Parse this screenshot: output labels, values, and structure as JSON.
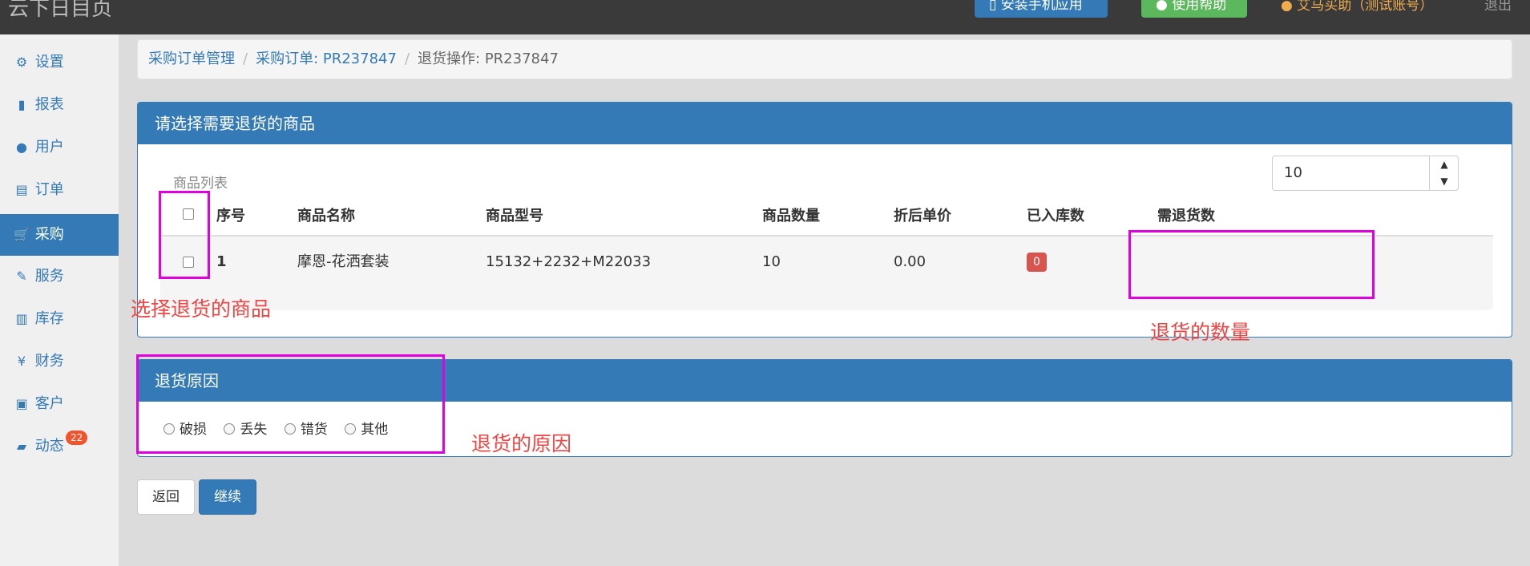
{
  "topbar": {
    "brand": "云下日目页",
    "install_label": "安装手机应用",
    "help_label": "使用帮助",
    "user_label": "艾马买助（测试账号）",
    "exit_label": "退出"
  },
  "sidebar": {
    "items": [
      {
        "label": "设置",
        "icon": "gear-icon",
        "glyph": "⚙"
      },
      {
        "label": "报表",
        "icon": "bar-chart-icon",
        "glyph": "▮"
      },
      {
        "label": "用户",
        "icon": "user-icon",
        "glyph": "●"
      },
      {
        "label": "订单",
        "icon": "list-icon",
        "glyph": "▤"
      },
      {
        "label": "采购",
        "icon": "cart-icon",
        "glyph": "🛒"
      },
      {
        "label": "服务",
        "icon": "wrench-icon",
        "glyph": "✎"
      },
      {
        "label": "库存",
        "icon": "barcode-icon",
        "glyph": "▥"
      },
      {
        "label": "财务",
        "icon": "yen-icon",
        "glyph": "¥"
      },
      {
        "label": "客户",
        "icon": "briefcase-icon",
        "glyph": "▣"
      },
      {
        "label": "动态",
        "icon": "comment-icon",
        "glyph": "▰",
        "badge": "22"
      }
    ],
    "active": "采购"
  },
  "breadcrumb": {
    "items": [
      "采购订单管理",
      "采购订单: PR237847"
    ],
    "current": "退货操作: PR237847",
    "sep": "/"
  },
  "panel_items": {
    "title": "请选择需要退货的商品",
    "list_title": "商品列表",
    "columns": [
      "序号",
      "商品名称",
      "商品型号",
      "商品数量",
      "折后单价",
      "已入库数",
      "需退货数"
    ],
    "rows": [
      {
        "index": "1",
        "name": "摩恩-花洒套装",
        "model": "15132+2232+M22033",
        "qty": "10",
        "price": "0.00",
        "received": "0",
        "return_qty": "10"
      }
    ]
  },
  "panel_reason": {
    "title": "退货原因",
    "options": [
      "破损",
      "丢失",
      "错货",
      "其他"
    ]
  },
  "actions": {
    "back_label": "返回",
    "next_label": "继续"
  },
  "annotations": {
    "select_items": "选择退货的商品",
    "return_qty": "退货的数量",
    "return_reason": "退货的原因",
    "color": "#f04545",
    "box_color": "#e000e0"
  },
  "colors": {
    "primary": "#337ab7",
    "success": "#5cb85c",
    "danger": "#d9534f",
    "topbar": "#3a3a3a"
  }
}
